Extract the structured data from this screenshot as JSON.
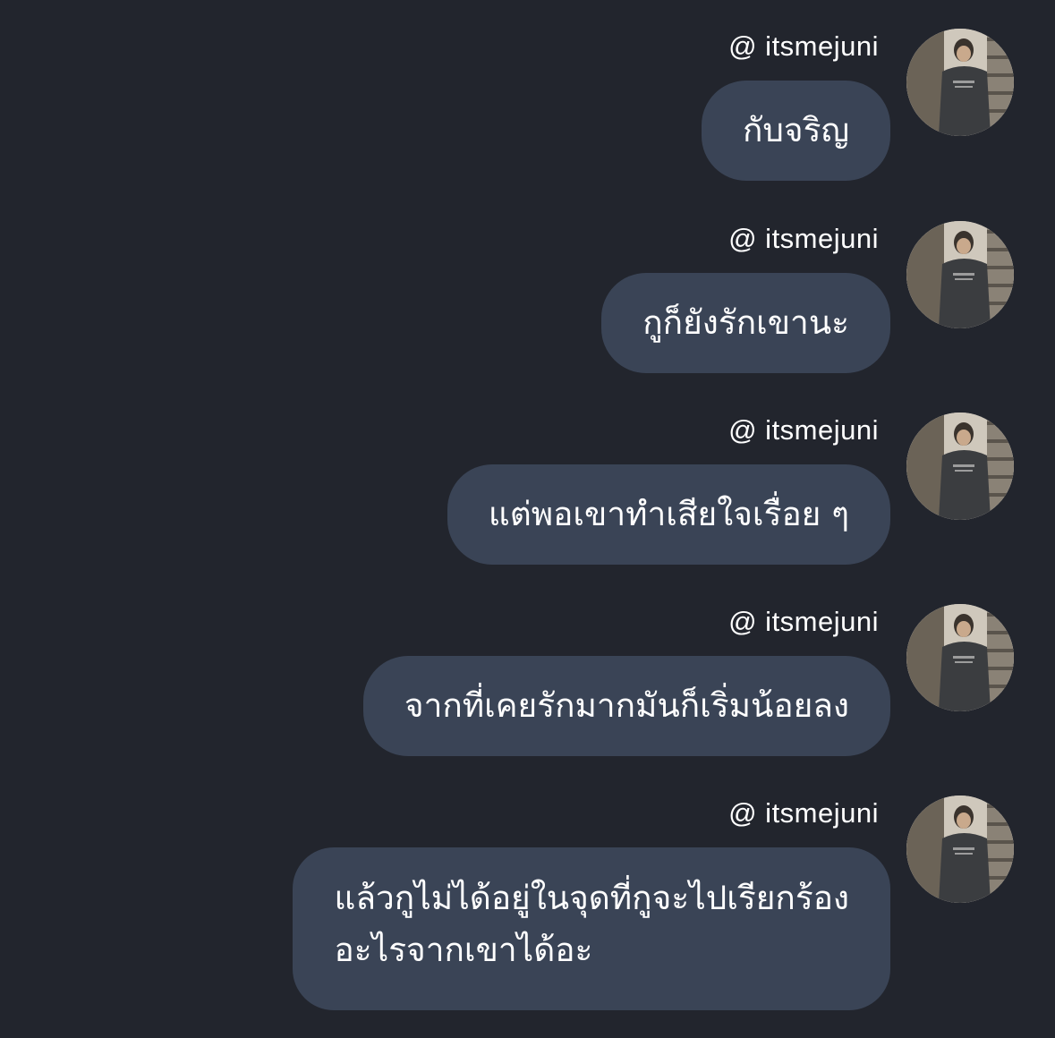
{
  "messages": [
    {
      "username": "@ itsmejuni",
      "text": "กับจริญ"
    },
    {
      "username": "@ itsmejuni",
      "text": "กูก็ยังรักเขานะ"
    },
    {
      "username": "@ itsmejuni",
      "text": "แต่พอเขาทำเสียใจเรื่อย ๆ"
    },
    {
      "username": "@ itsmejuni",
      "text": "จากที่เคยรักมากมันก็เริ่มน้อยลง"
    },
    {
      "username": "@ itsmejuni",
      "lines": [
        "แล้วกูไม่ได้อยู่ในจุดที่กูจะไปเรียกร้อง",
        "อะไรจากเขาได้อะ"
      ]
    }
  ],
  "icons": {
    "avatar": "user-photo-avatar"
  },
  "colors": {
    "background": "#22252d",
    "bubble": "#3a4456",
    "text": "#ffffff"
  }
}
